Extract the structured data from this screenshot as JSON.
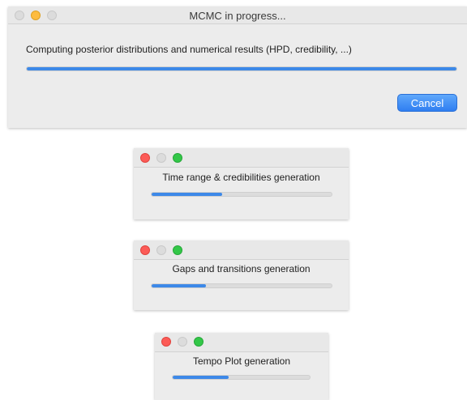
{
  "main_dialog": {
    "title": "MCMC in progress...",
    "message": "Computing posterior distributions and numerical results (HPD, credibility, ...)",
    "progress": 1.0,
    "cancel_label": "Cancel"
  },
  "sub_windows": [
    {
      "message": "Time range & credibilities generation",
      "progress": 0.39
    },
    {
      "message": "Gaps and transitions generation",
      "progress": 0.3
    },
    {
      "message": "Tempo Plot generation",
      "progress": 0.41
    }
  ],
  "colors": {
    "accent": "#3d89e8",
    "close": "#fc5b57",
    "minimize": "#fdbc40",
    "zoom": "#33c748"
  }
}
